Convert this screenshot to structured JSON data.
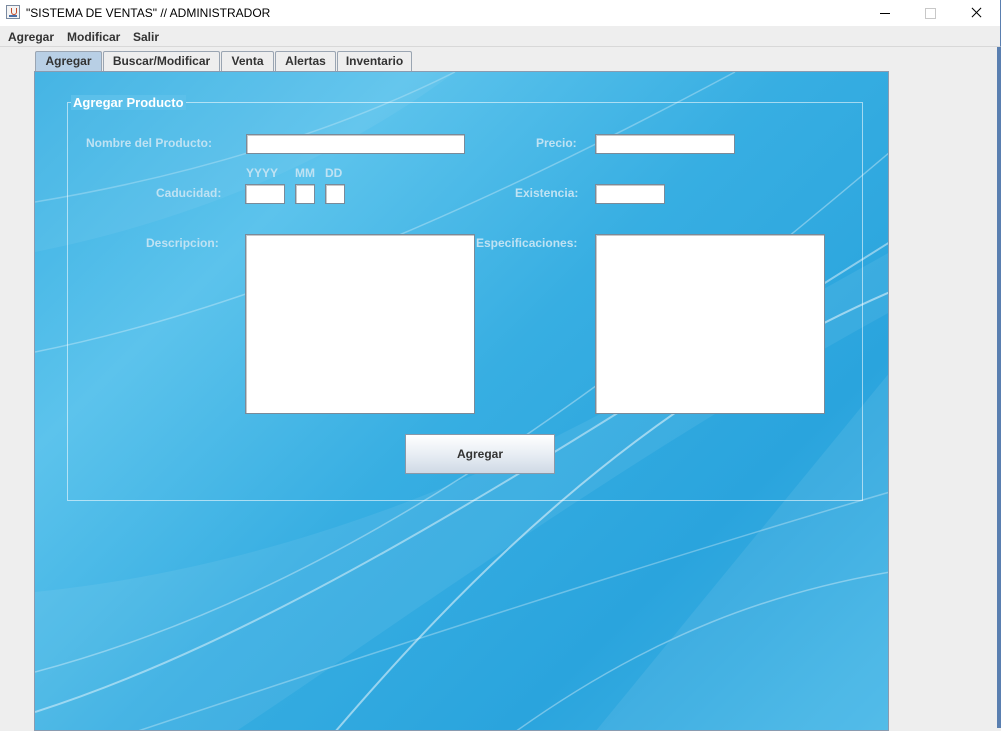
{
  "window": {
    "title": "\"SISTEMA DE VENTAS\" // ADMINISTRADOR"
  },
  "menu": {
    "items": [
      "Agregar",
      "Modificar",
      "Salir"
    ]
  },
  "tabs": [
    {
      "label": "Agregar",
      "active": true
    },
    {
      "label": "Buscar/Modificar",
      "active": false
    },
    {
      "label": "Venta",
      "active": false
    },
    {
      "label": "Alertas",
      "active": false
    },
    {
      "label": "Inventario",
      "active": false
    }
  ],
  "form": {
    "legend": "Agregar Producto",
    "nombre_label": "Nombre del Producto:",
    "nombre_value": "",
    "precio_label": "Precio:",
    "precio_value": "",
    "caducidad_label": "Caducidad:",
    "yyyy_label": "YYYY",
    "mm_label": "MM",
    "dd_label": "DD",
    "existencia_label": "Existencia:",
    "existencia_value": "",
    "descripcion_label": "Descripcion:",
    "descripcion_value": "",
    "especificaciones_label": "Especificaciones:",
    "especificaciones_value": "",
    "submit_label": "Agregar"
  },
  "colors": {
    "panel_blue": "#3ab0e3",
    "label_color": "#bfe2f3",
    "active_tab": "#b8cfe5"
  }
}
